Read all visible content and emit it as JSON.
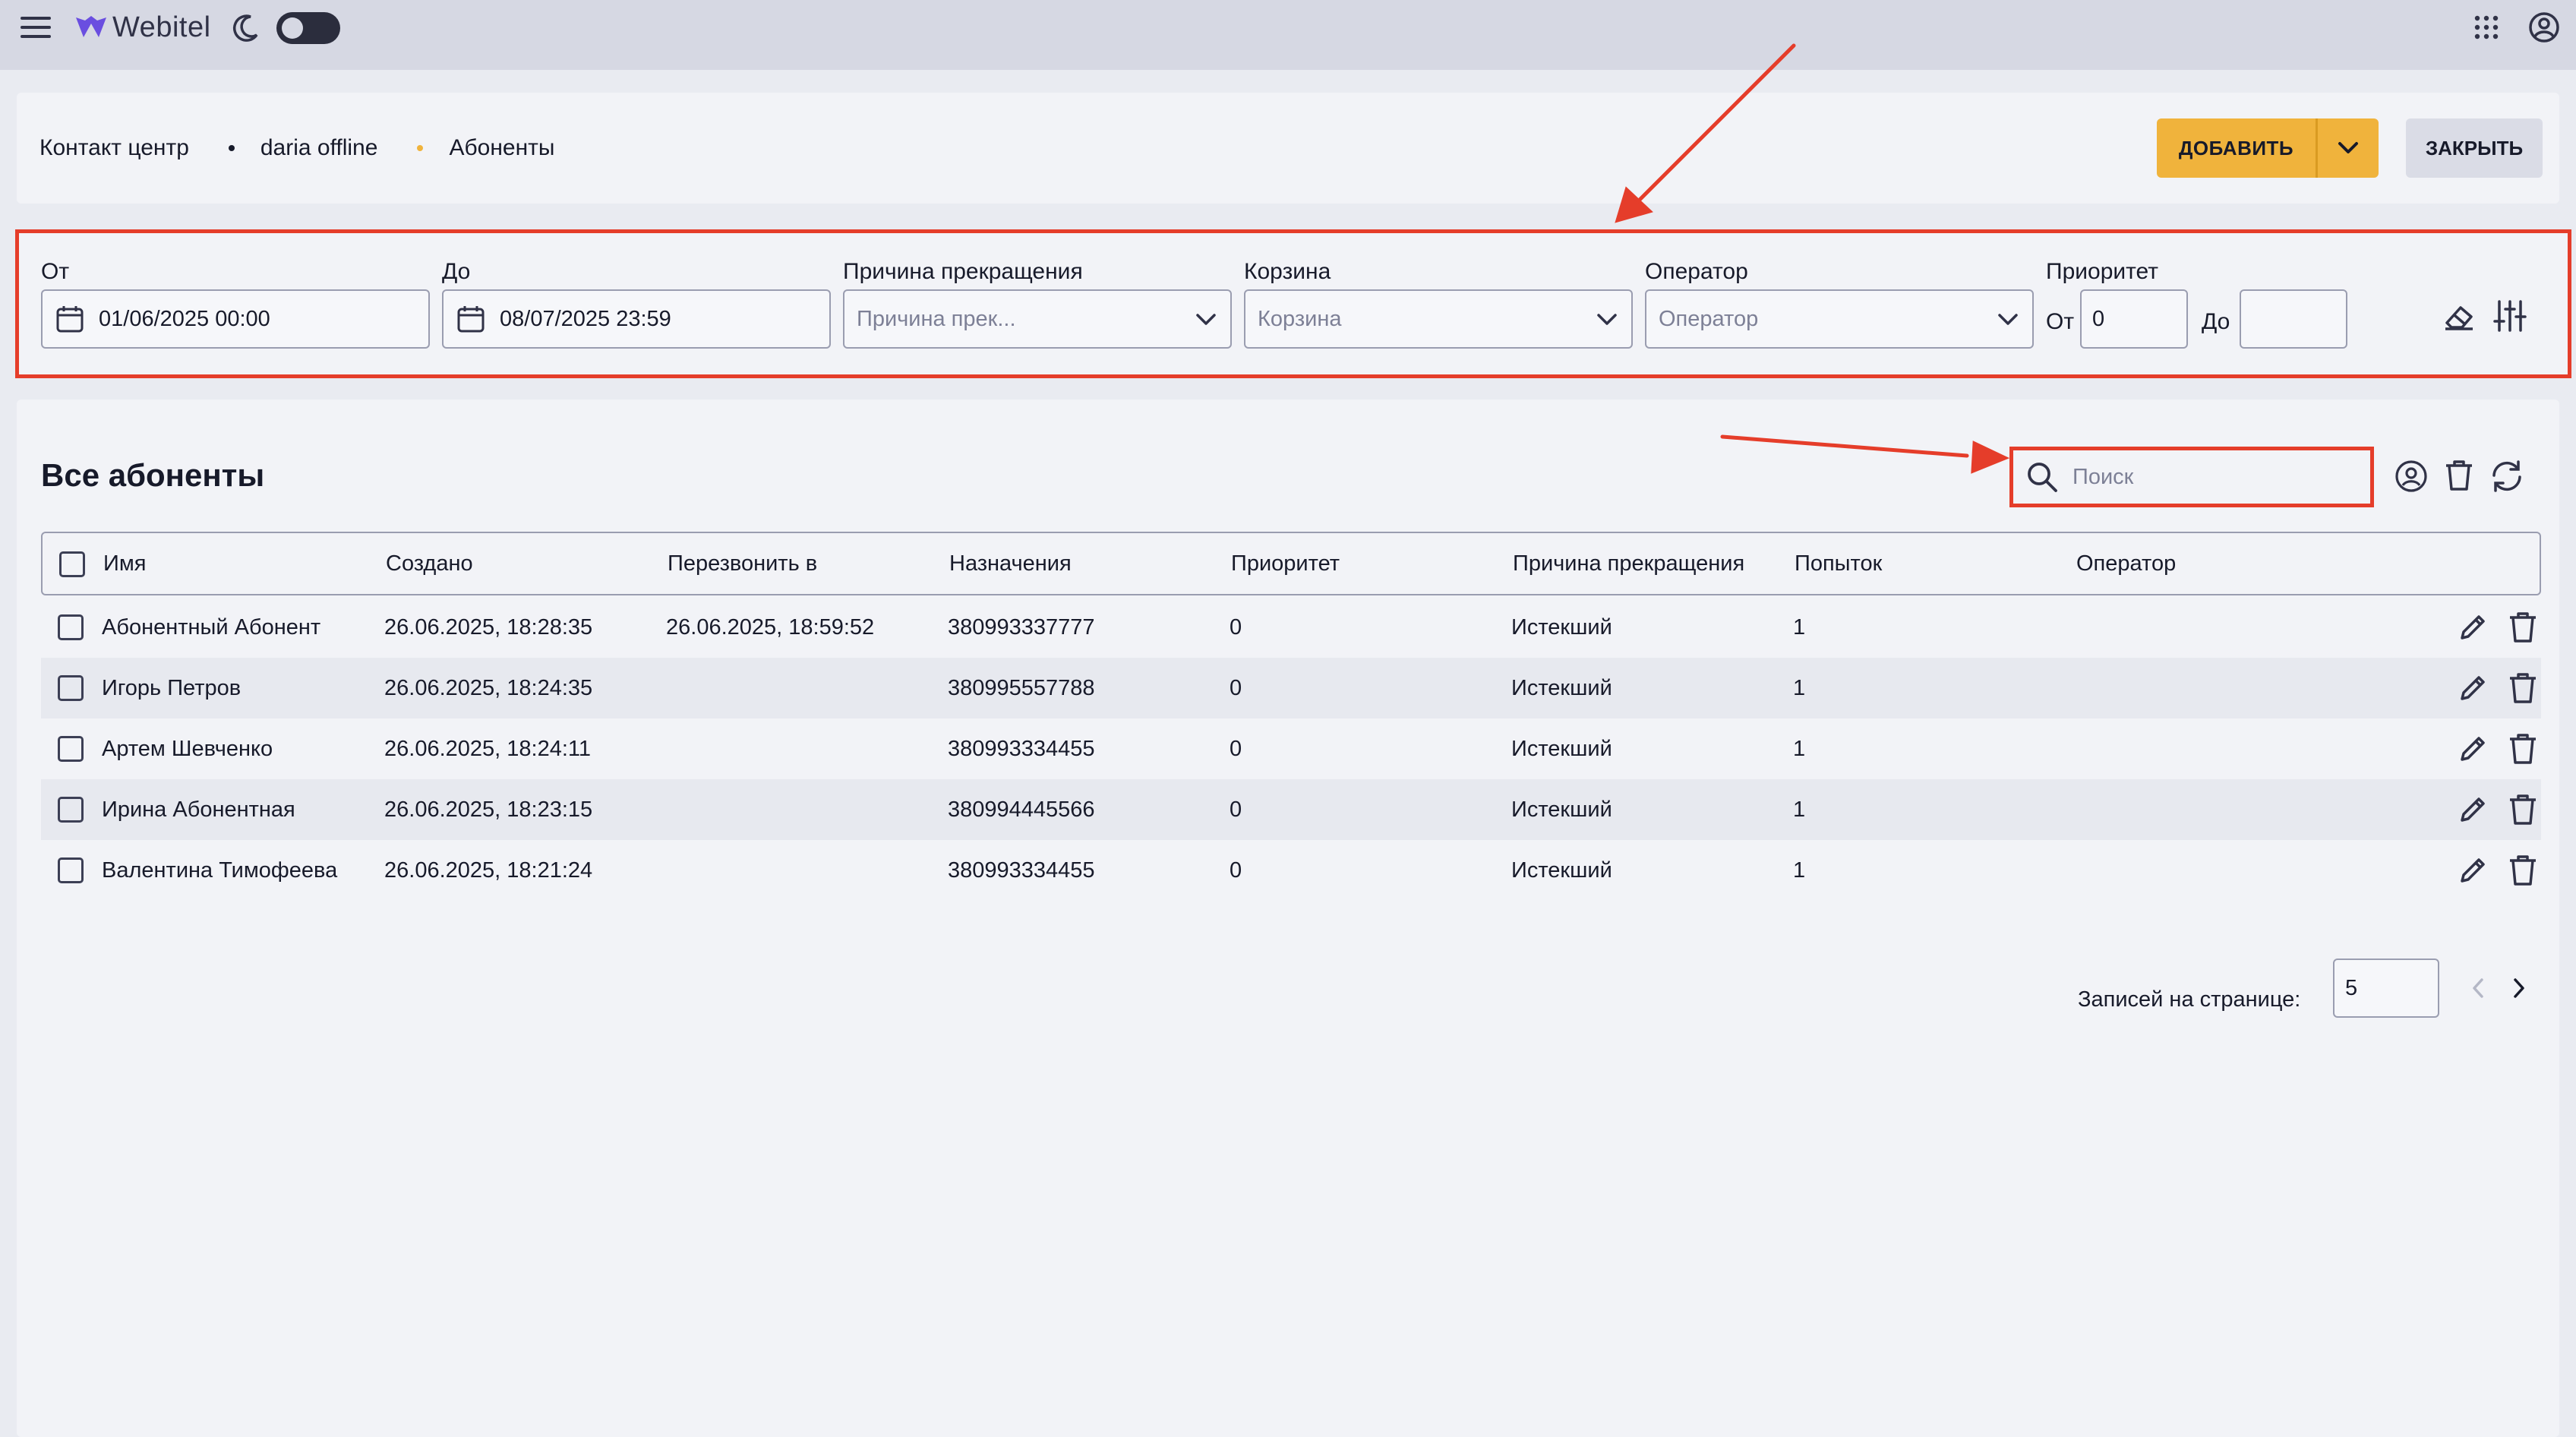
{
  "app": {
    "name": "Webitel"
  },
  "header": {
    "breadcrumbs": [
      "Контакт центр",
      "daria offline",
      "Абоненты"
    ],
    "add_label": "ДОБАВИТЬ",
    "close_label": "ЗАКРЫТЬ"
  },
  "filters": {
    "from": {
      "label": "От",
      "value": "01/06/2025 00:00"
    },
    "to": {
      "label": "До",
      "value": "08/07/2025 23:59"
    },
    "reason": {
      "label": "Причина прекращения",
      "placeholder": "Причина прек..."
    },
    "bucket": {
      "label": "Корзина",
      "placeholder": "Корзина"
    },
    "operator": {
      "label": "Оператор",
      "placeholder": "Оператор"
    },
    "priority": {
      "label": "Приоритет",
      "from_label": "От",
      "from_value": "0",
      "to_label": "До",
      "to_value": ""
    }
  },
  "main": {
    "title": "Все абоненты",
    "search_placeholder": "Поиск",
    "columns": [
      "Имя",
      "Создано",
      "Перезвонить в",
      "Назначения",
      "Приоритет",
      "Причина прекращения",
      "Попыток",
      "Оператор"
    ],
    "rows": [
      [
        "Абонентный Абонент",
        "26.06.2025, 18:28:35",
        "26.06.2025, 18:59:52",
        "380993337777",
        "0",
        "Истекший",
        "1",
        ""
      ],
      [
        "Игорь Петров",
        "26.06.2025, 18:24:35",
        "",
        "380995557788",
        "0",
        "Истекший",
        "1",
        ""
      ],
      [
        "Артем Шевченко",
        "26.06.2025, 18:24:11",
        "",
        "380993334455",
        "0",
        "Истекший",
        "1",
        ""
      ],
      [
        "Ирина Абонентная",
        "26.06.2025, 18:23:15",
        "",
        "380994445566",
        "0",
        "Истекший",
        "1",
        ""
      ],
      [
        "Валентина Тимофеева",
        "26.06.2025, 18:21:24",
        "",
        "380993334455",
        "0",
        "Истекший",
        "1",
        ""
      ]
    ]
  },
  "pagination": {
    "label": "Записей на странице:",
    "per_page": "5"
  },
  "colors": {
    "accent": "#f0b33c",
    "annotation": "#e53d2a",
    "topbar": "#d6d8e3"
  },
  "icons": [
    "menu-icon",
    "webitel-logo-icon",
    "moon-icon",
    "theme-toggle",
    "apps-grid-icon",
    "account-icon",
    "calendar-icon",
    "chevron-down-icon",
    "eraser-icon",
    "sliders-icon",
    "search-icon",
    "user-sync-icon",
    "trash-icon",
    "refresh-icon",
    "edit-icon",
    "chevron-left-icon",
    "chevron-right-icon"
  ]
}
